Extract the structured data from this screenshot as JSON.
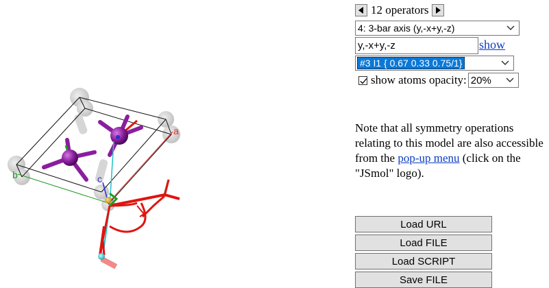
{
  "operators": {
    "count_label": "12 operators",
    "selected_operator": "4: 3-bar axis (y,-x+y,-z)",
    "xyz_value": "y,-x+y,-z",
    "show_link": "show",
    "selected_atom": "#3 I1 { 0.67 0.33 0.75/1}"
  },
  "opacity": {
    "checked": true,
    "label": "show atoms opacity:",
    "selected": "20%"
  },
  "note": {
    "line1": "Note that all symmetry operations relating to this model are also accessible from the",
    "link": "pop-up menu",
    "line2": "(click on the \"JSmol\" logo)."
  },
  "buttons": {
    "load_url": "Load URL",
    "load_file": "Load FILE",
    "load_script": "Load SCRIPT",
    "save_file": "Save FILE"
  },
  "viewer": {
    "axis_labels": {
      "a": "a",
      "b": "b",
      "c": "c"
    },
    "colors": {
      "axis_a": "#e0302a",
      "axis_b": "#1f9a1f",
      "axis_c": "#2b2fcf",
      "iodine": "#8a1e9e",
      "symmetry_element": "#e0140f",
      "cell_edge": "#111111",
      "ghost_atom": "#c8c8c8",
      "cyan": "#1fc2c8"
    },
    "icons": [
      "prev-arrow-icon",
      "next-arrow-icon",
      "chevron-down-icon",
      "checkmark-icon"
    ]
  }
}
